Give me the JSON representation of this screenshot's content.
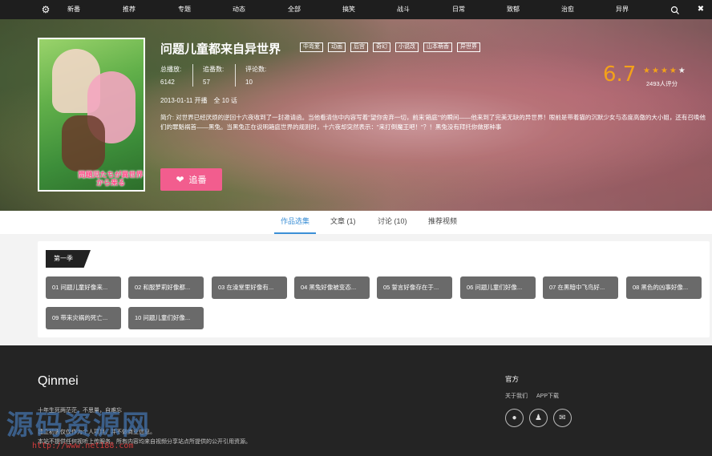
{
  "nav": {
    "items": [
      "新番",
      "推荐",
      "专题",
      "动态",
      "全部",
      "搞笑",
      "战斗",
      "日常",
      "致郁",
      "治愈",
      "异界"
    ]
  },
  "anime": {
    "title": "问题儿童都来自异世界",
    "tags": [
      "中岛爱",
      "动画",
      "后宫",
      "奇幻",
      "小说改",
      "山本萌香",
      "异世界"
    ],
    "stats": [
      {
        "label": "总播放:",
        "value": "6142"
      },
      {
        "label": "追番数:",
        "value": "57"
      },
      {
        "label": "评论数:",
        "value": "10"
      }
    ],
    "air_info": "2013-01-11 开播　全 10 话",
    "description": "简介: 对世界已经厌烦的逆回十六夜收到了一封邀请函。当他看清信中内容写着\"望你舍弃一切，前来'箱庭'\"的瞬间——他来到了完美无缺的异世界！眼前是带着猫的沉默少女与态度高傲的大小姐，还有召唤他们的罪魁祸首——黑兔。当黑兔正在说明箱庭世界的规则时，十六夜却突然表示：\"来打倒魔王吧！\"？！黑兔没有拜托你做那种事",
    "score": "6.7",
    "rating": 3.5,
    "raters": "2493人评分",
    "follow_label": "追番",
    "poster_text": "問題児たちが異世界から来る"
  },
  "tabs": [
    "作品选集",
    "文章 (1)",
    "讨论 (10)",
    "推荐视频"
  ],
  "season_label": "第一季",
  "episodes": [
    "01 问题儿童好像来...",
    "02 和服萝莉好像都...",
    "03 在澡堂里好像有...",
    "04 黑兔好像被变态...",
    "05 誓言好像存在于...",
    "06 问题儿童们好像...",
    "07 在黑暗中飞鸟好...",
    "08 黑色的凶事好像...",
    "09 带来灾祸的死亡...",
    "10 问题儿童们好像..."
  ],
  "footer": {
    "brand": "Qinmei",
    "lines": [
      "十年生死两茫茫，不思量，自难忘",
      "建立初衷仅仅作为个人项目，并不做商业信息。",
      "本站不提供任何视听上传服务，所有内容均来自视频分享站点所提供的公开引用资源。"
    ],
    "official_title": "官方",
    "links": [
      "关于我们",
      "APP下载"
    ],
    "watermark": "源码资源网",
    "watermark_url": "http://www.net188.com"
  }
}
